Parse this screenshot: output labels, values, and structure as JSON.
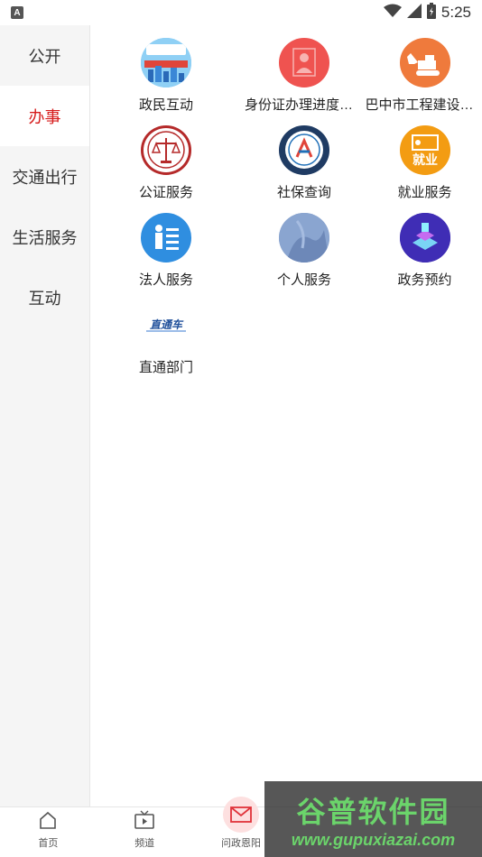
{
  "status": {
    "time": "5:25",
    "indicator": "A"
  },
  "sidebar": {
    "items": [
      {
        "label": "公开",
        "active": false
      },
      {
        "label": "办事",
        "active": true
      },
      {
        "label": "交通出行",
        "active": false
      },
      {
        "label": "生活服务",
        "active": false
      },
      {
        "label": "互动",
        "active": false
      }
    ]
  },
  "grid": {
    "rows": [
      [
        {
          "label": "政民互动",
          "icon": "politics-interaction-icon"
        },
        {
          "label": "身份证办理进度查询",
          "icon": "id-card-icon"
        },
        {
          "label": "巴中市工程建设项…",
          "icon": "excavator-icon"
        }
      ],
      [
        {
          "label": "公证服务",
          "icon": "notary-scales-icon"
        },
        {
          "label": "社保查询",
          "icon": "social-security-icon"
        },
        {
          "label": "就业服务",
          "icon": "employment-icon"
        }
      ],
      [
        {
          "label": "法人服务",
          "icon": "legal-person-icon"
        },
        {
          "label": "个人服务",
          "icon": "personal-service-icon"
        },
        {
          "label": "政务预约",
          "icon": "appointment-icon"
        }
      ],
      [
        {
          "label": "直通部门",
          "icon": "direct-department-icon"
        }
      ]
    ],
    "direct_logo_text": "直通车",
    "social_logo_text": "巴中人力资源和社会保障",
    "notary_logo_text": "公证"
  },
  "bottom_nav": {
    "items": [
      {
        "label": "首页",
        "icon": "home-icon"
      },
      {
        "label": "频道",
        "icon": "tv-icon"
      },
      {
        "label": "问政恩阳",
        "icon": "mail-icon"
      },
      {
        "label": "",
        "icon": ""
      },
      {
        "label": "",
        "icon": ""
      }
    ]
  },
  "watermark": {
    "title": "谷普软件园",
    "url": "www.gupuxiazai.com"
  },
  "colors": {
    "accent": "#d61c1c",
    "sidebar_bg": "#f5f5f5"
  }
}
